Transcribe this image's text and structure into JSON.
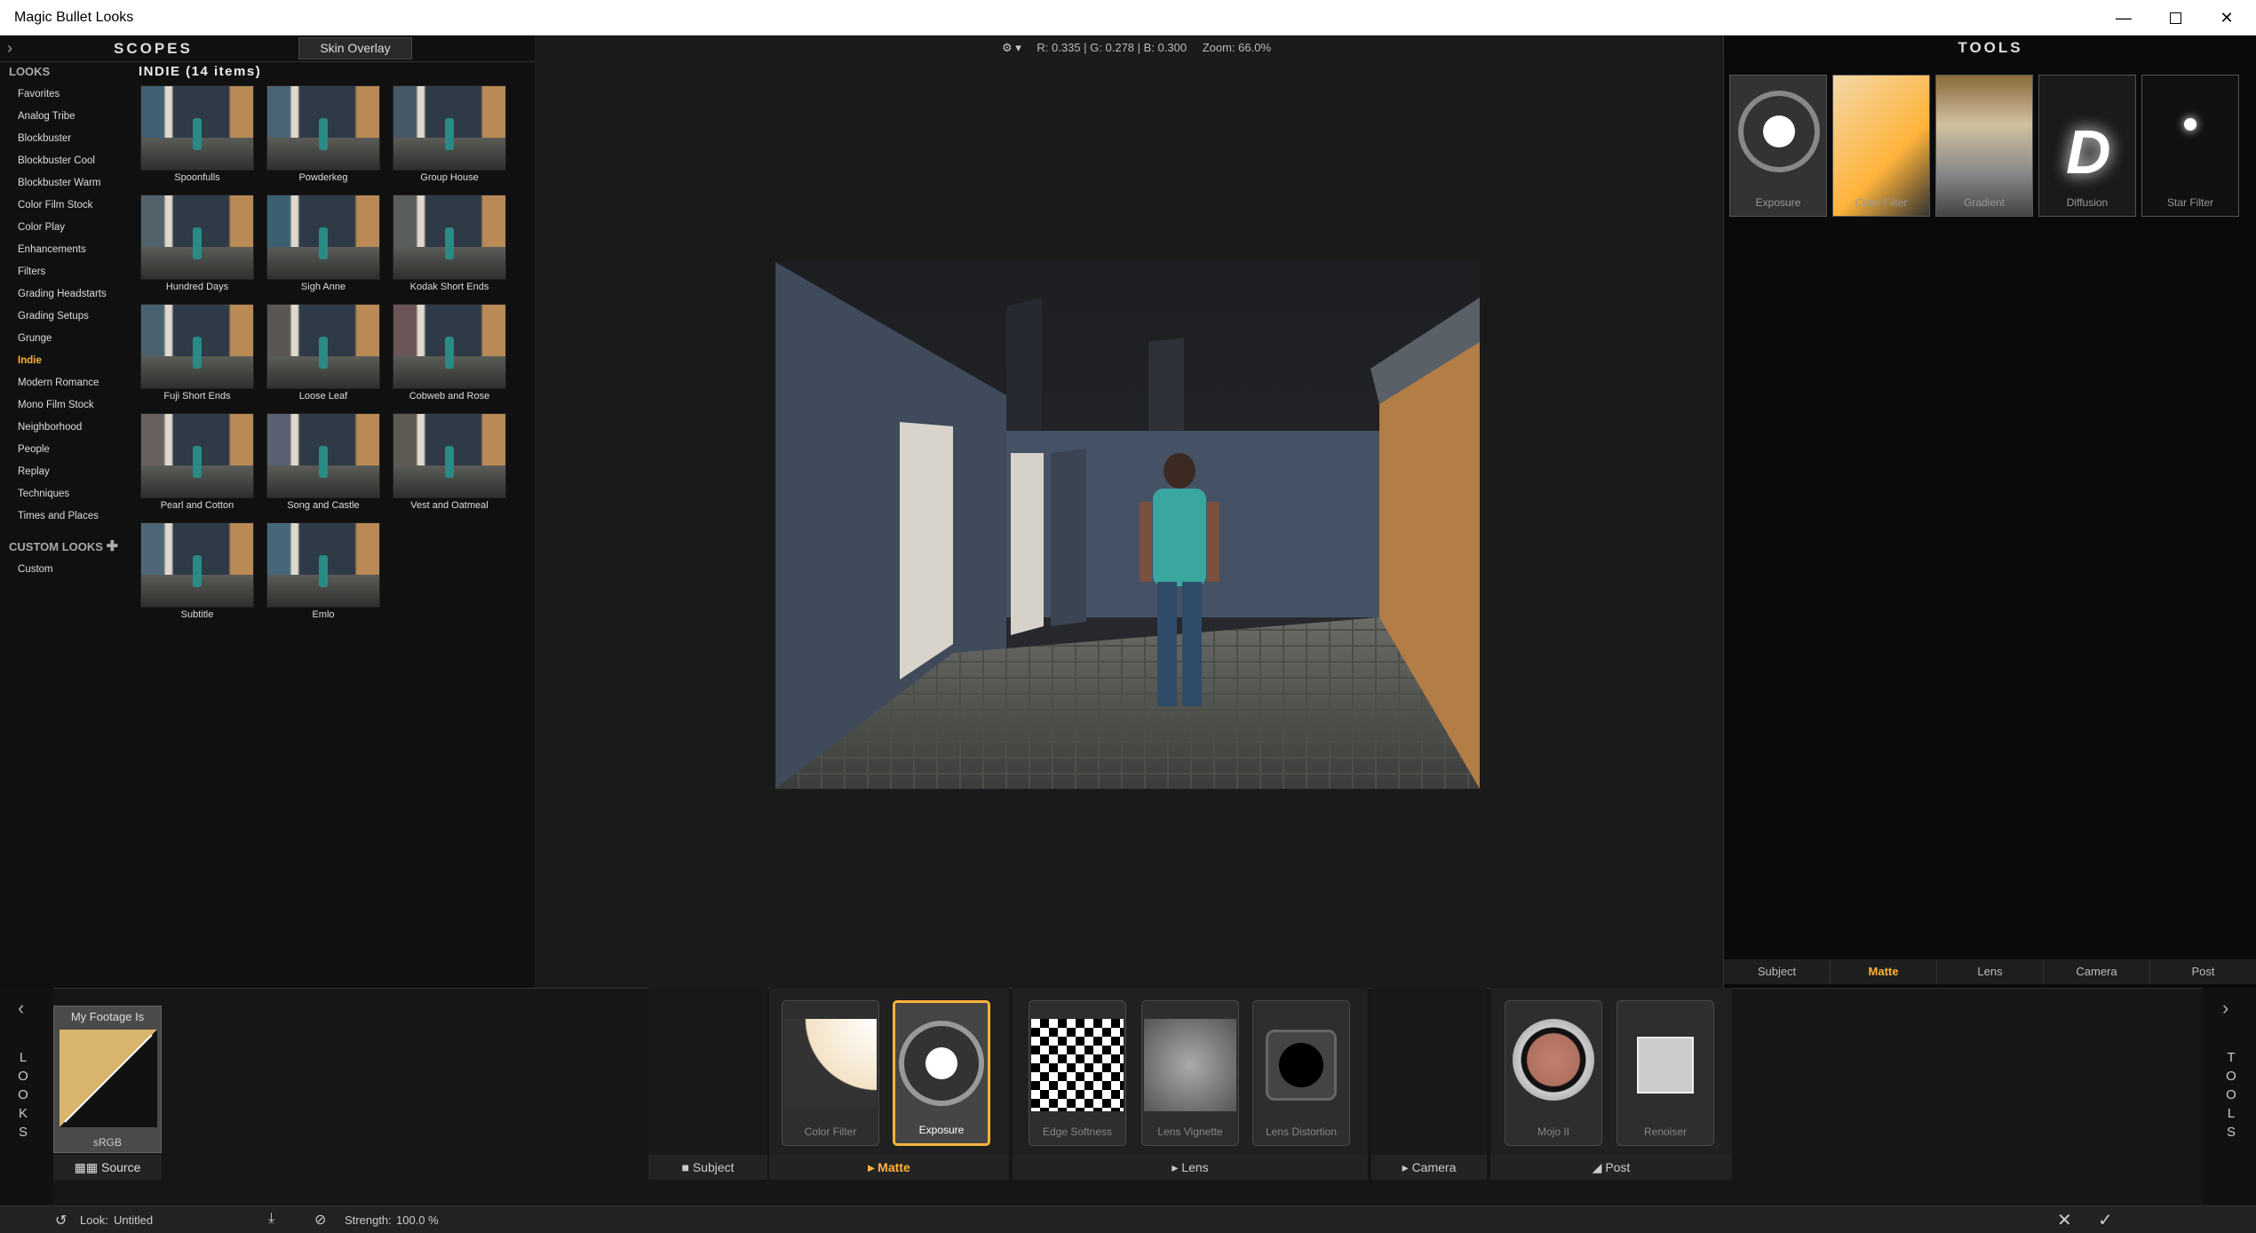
{
  "window": {
    "title": "Magic Bullet Looks",
    "controls": [
      "minimize",
      "maximize",
      "close"
    ]
  },
  "scopes": {
    "label": "SCOPES",
    "skin_overlay": "Skin Overlay"
  },
  "readout": {
    "rgb": "R: 0.335 | G: 0.278 | B: 0.300",
    "zoom": "Zoom:  66.0%"
  },
  "looks": {
    "header": "LOOKS",
    "categories": [
      "Favorites",
      "Analog Tribe",
      "Blockbuster",
      "Blockbuster Cool",
      "Blockbuster Warm",
      "Color Film Stock",
      "Color Play",
      "Enhancements",
      "Filters",
      "Grading Headstarts",
      "Grading Setups",
      "Grunge",
      "Indie",
      "Modern Romance",
      "Mono Film Stock",
      "Neighborhood",
      "People",
      "Replay",
      "Techniques",
      "Times and Places"
    ],
    "active_category": "Indie",
    "custom_header": "CUSTOM LOOKS",
    "custom_items": [
      "Custom"
    ],
    "grid_title": "INDIE (14 items)",
    "items": [
      "Spoonfulls",
      "Powderkeg",
      "Group House",
      "Hundred Days",
      "Sigh Anne",
      "Kodak Short Ends",
      "Fuji Short Ends",
      "Loose Leaf",
      "Cobweb and Rose",
      "Pearl and Cotton",
      "Song and Castle",
      "Vest and Oatmeal",
      "Subtitle",
      "Emlo"
    ]
  },
  "tools": {
    "header": "TOOLS",
    "items": [
      "Exposure",
      "Color Filter",
      "Gradient",
      "Diffusion",
      "Star Filter"
    ],
    "tabs": [
      "Subject",
      "Matte",
      "Lens",
      "Camera",
      "Post"
    ],
    "active_tab": "Matte"
  },
  "chain": {
    "source": {
      "title": "My Footage Is",
      "profile": "sRGB",
      "label": "Source"
    },
    "matte_nodes": [
      "Color Filter",
      "Exposure"
    ],
    "lens_nodes": [
      "Edge Softness",
      "Lens Vignette",
      "Lens Distortion"
    ],
    "post_nodes": [
      "Mojo II",
      "Renoiser"
    ],
    "groups": [
      "Subject",
      "Matte",
      "Lens",
      "Camera",
      "Post"
    ],
    "active_group": "Matte",
    "selected_node": "Exposure",
    "left_vertical": "LOOKS",
    "right_vertical": "TOOLS"
  },
  "status": {
    "look_label": "Look:",
    "look_name": "Untitled",
    "strength_label": "Strength:",
    "strength_value": "100.0 %"
  },
  "colors": {
    "accent": "#ffb43a"
  }
}
